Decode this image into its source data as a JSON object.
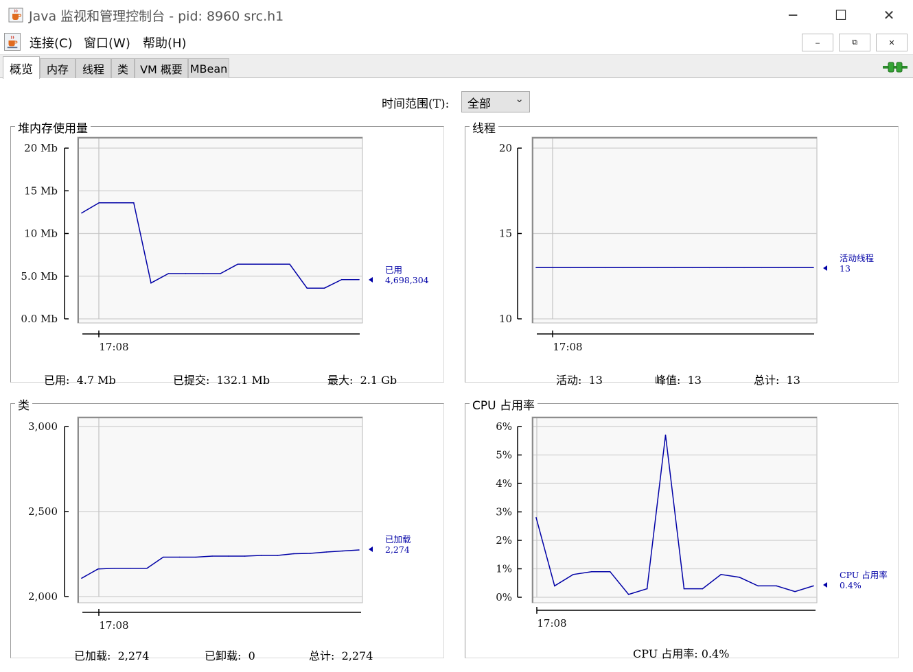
{
  "window": {
    "title": "Java 监视和管理控制台 - pid: 8960 src.h1",
    "minimize_glyph": "─",
    "maximize_glyph": "☐",
    "close_glyph": "✕"
  },
  "menu": {
    "items": [
      "连接(C)",
      "窗口(W)",
      "帮助(H)"
    ],
    "mdi_buttons": [
      "‒",
      "⧉",
      "✕"
    ]
  },
  "tabs": [
    "概览",
    "内存",
    "线程",
    "类",
    "VM 概要",
    "MBean"
  ],
  "active_tab": 0,
  "time_range": {
    "label": "时间范围(T):",
    "selected": "全部"
  },
  "icons": {
    "app": "java-cup-icon",
    "connection": "connection-plug-icon",
    "dropdown": "chevron-down-icon"
  },
  "colors": {
    "series": "#0000a6",
    "plot_bg": "#f8f8f8",
    "grid": "#cfcfcf"
  },
  "panels": {
    "heap": {
      "title": "堆内存使用量",
      "time_label": "17:08",
      "legend_name": "已用",
      "legend_value": "4,698,304",
      "summary": [
        {
          "label": "已用:",
          "value": "4.7  Mb"
        },
        {
          "label": "已提交:",
          "value": "132.1  Mb"
        },
        {
          "label": "最大:",
          "value": "2.1  Gb"
        }
      ]
    },
    "threads": {
      "title": "线程",
      "time_label": "17:08",
      "legend_name": "活动线程",
      "legend_value": "13",
      "summary": [
        {
          "label": "活动:",
          "value": "13"
        },
        {
          "label": "峰值:",
          "value": "13"
        },
        {
          "label": "总计:",
          "value": "13"
        }
      ]
    },
    "classes": {
      "title": "类",
      "time_label": "17:08",
      "legend_name": "已加载",
      "legend_value": "2,274",
      "summary": [
        {
          "label": "已加载:",
          "value": "2,274"
        },
        {
          "label": "已卸载:",
          "value": "0"
        },
        {
          "label": "总计:",
          "value": "2,274"
        }
      ]
    },
    "cpu": {
      "title": "CPU 占用率",
      "time_label": "17:08",
      "legend_name": "CPU 占用率",
      "legend_value": "0.4%",
      "summary_text": "CPU 占用率: 0.4%"
    }
  },
  "chart_data": [
    {
      "id": "heap",
      "type": "line",
      "ylim": [
        0,
        20
      ],
      "yticks": [
        0,
        5,
        10,
        15,
        20
      ],
      "ytick_labels": [
        "0.0 Mb",
        "5.0 Mb",
        "10 Mb",
        "15 Mb",
        "20 Mb"
      ],
      "xtick_labels": [
        "17:08"
      ],
      "series": [
        {
          "name": "已用",
          "values": [
            12.4,
            13.6,
            13.6,
            13.6,
            4.2,
            5.3,
            5.3,
            5.3,
            5.3,
            6.4,
            6.4,
            6.4,
            6.4,
            3.6,
            3.6,
            4.6,
            4.6
          ]
        }
      ]
    },
    {
      "id": "threads",
      "type": "line",
      "ylim": [
        10,
        20
      ],
      "yticks": [
        10,
        15,
        20
      ],
      "ytick_labels": [
        "10",
        "15",
        "20"
      ],
      "xtick_labels": [
        "17:08"
      ],
      "series": [
        {
          "name": "活动线程",
          "values": [
            13,
            13,
            13,
            13,
            13,
            13,
            13,
            13,
            13,
            13,
            13,
            13,
            13,
            13,
            13,
            13,
            13
          ]
        }
      ]
    },
    {
      "id": "classes",
      "type": "line",
      "ylim": [
        2000,
        3000
      ],
      "yticks": [
        2000,
        2500,
        3000
      ],
      "ytick_labels": [
        "2,000",
        "2,500",
        "3,000"
      ],
      "xtick_labels": [
        "17:08"
      ],
      "series": [
        {
          "name": "已加载",
          "values": [
            2108,
            2162,
            2166,
            2166,
            2166,
            2232,
            2232,
            2232,
            2238,
            2238,
            2238,
            2242,
            2242,
            2252,
            2254,
            2262,
            2268,
            2274
          ]
        }
      ]
    },
    {
      "id": "cpu",
      "type": "line",
      "ylim": [
        0,
        6
      ],
      "yticks": [
        0,
        1,
        2,
        3,
        4,
        5,
        6
      ],
      "ytick_labels": [
        "0%",
        "1%",
        "2%",
        "3%",
        "4%",
        "5%",
        "6%"
      ],
      "xtick_labels": [
        "17:08"
      ],
      "series": [
        {
          "name": "CPU 占用率",
          "values": [
            2.8,
            0.4,
            0.8,
            0.9,
            0.9,
            0.1,
            0.3,
            5.7,
            0.3,
            0.3,
            0.8,
            0.7,
            0.4,
            0.4,
            0.2,
            0.4
          ]
        }
      ]
    }
  ]
}
